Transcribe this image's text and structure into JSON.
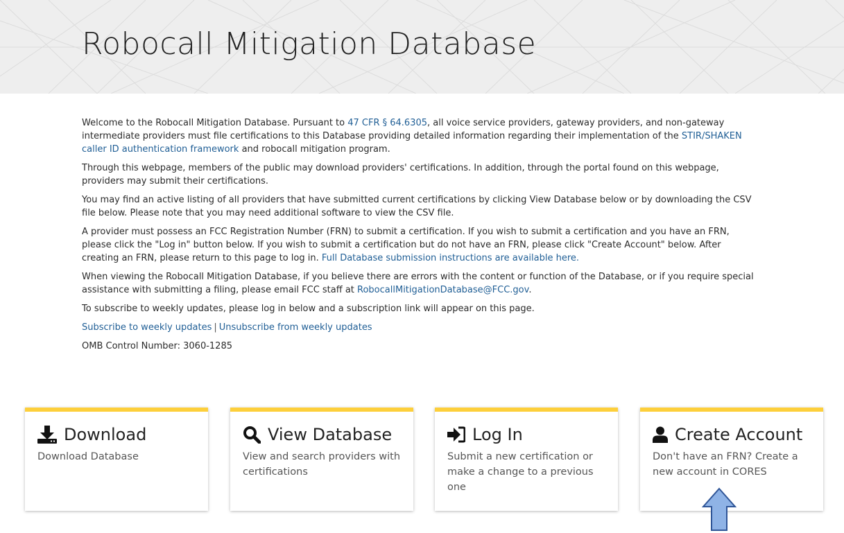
{
  "header": {
    "title": "Robocall Mitigation Database"
  },
  "intro": {
    "p1_a": "Welcome to the Robocall Mitigation Database. Pursuant to ",
    "p1_link1": "47 CFR § 64.6305",
    "p1_b": ", all voice service providers, gateway providers, and non-gateway intermediate providers must file certifications to this Database providing detailed information regarding their implementation of the ",
    "p1_link2": "STIR/SHAKEN caller ID authentication framework",
    "p1_c": " and robocall mitigation program.",
    "p2": "Through this webpage, members of the public may download providers' certifications. In addition, through the portal found on this webpage, providers may submit their certifications.",
    "p3": "You may find an active listing of all providers that have submitted current certifications by clicking View Database below or by downloading the CSV file below. Please note that you may need additional software to view the CSV file.",
    "p4_a": "A provider must possess an FCC Registration Number (FRN) to submit a certification. If you wish to submit a certification and you have an FRN, please click the \"Log in\" button below. If you wish to submit a certification but do not have an FRN, please click \"Create Account\" below. After creating an FRN, please return to this page to log in. ",
    "p4_link": "Full Database submission instructions are available here.",
    "p5_a": "When viewing the Robocall Mitigation Database, if you believe there are errors with the content or function of the Database, or if you require special assistance with submitting a filing, please email FCC staff at ",
    "p5_link": "RobocallMitigationDatabase@FCC.gov",
    "p5_b": ".",
    "p6": "To subscribe to weekly updates, please log in below and a subscription link will appear on this page.",
    "subscribe_link": "Subscribe to weekly updates",
    "separator": "|",
    "unsubscribe_link": "Unsubscribe from weekly updates",
    "omb": "OMB Control Number: 3060-1285"
  },
  "cards": [
    {
      "title": "Download",
      "desc": "Download Database",
      "icon": "download-icon"
    },
    {
      "title": "View Database",
      "desc": "View and search providers with certifications",
      "icon": "search-icon"
    },
    {
      "title": "Log In",
      "desc": "Submit a new certification or make a change to a previous one",
      "icon": "sign-in-icon"
    },
    {
      "title": "Create Account",
      "desc": "Don't have an FRN? Create a new account in CORES",
      "icon": "user-icon"
    }
  ],
  "colors": {
    "link": "#1f5e95",
    "card_accent": "#fdcf3b",
    "banner_bg": "#eeeeee",
    "arrow_fill": "#8fb3e6",
    "arrow_stroke": "#2f5597"
  }
}
